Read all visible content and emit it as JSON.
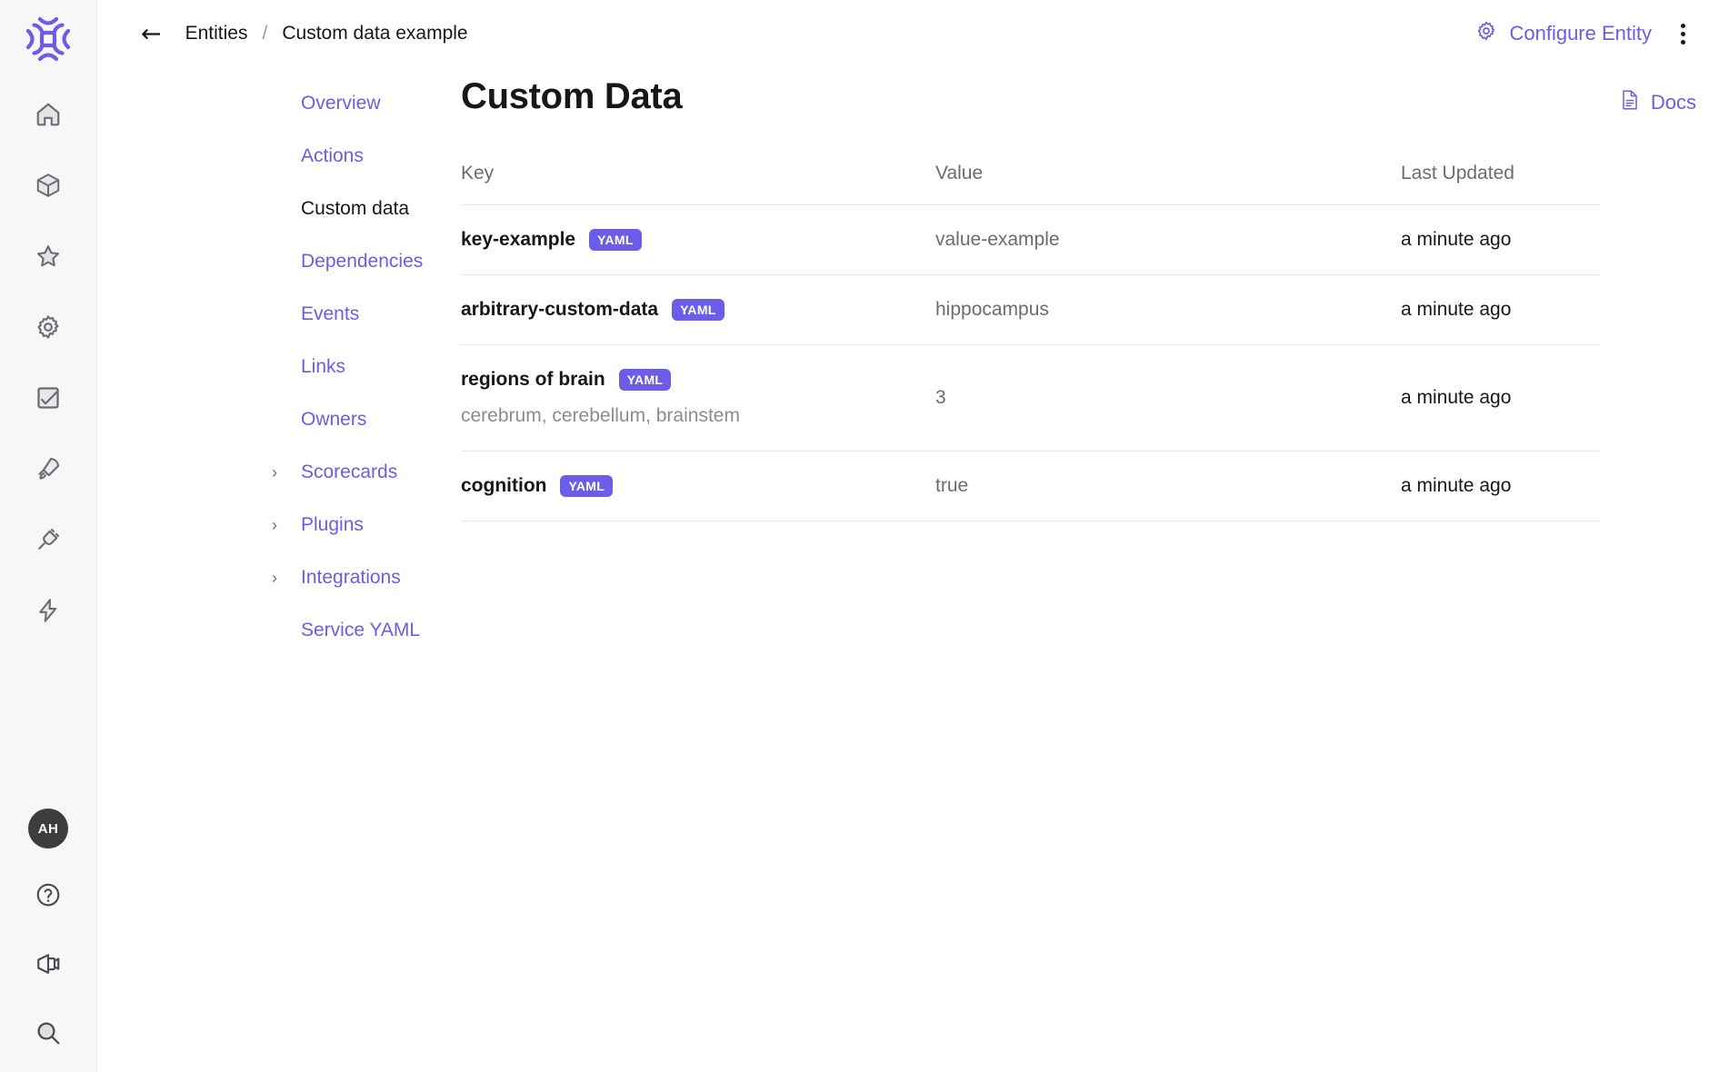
{
  "brand": {
    "logo_name": "cortex-logo",
    "accent": "#6c5ce7"
  },
  "rail": {
    "items": [
      {
        "icon": "home-icon"
      },
      {
        "icon": "cube-icon"
      },
      {
        "icon": "star-icon"
      },
      {
        "icon": "gear-icon"
      },
      {
        "icon": "checkbox-icon"
      },
      {
        "icon": "rocket-icon"
      },
      {
        "icon": "plug-icon"
      },
      {
        "icon": "lightning-icon"
      }
    ],
    "bottom": {
      "avatar_initials": "AH",
      "help_icon": "question-circle-icon",
      "announcements_icon": "megaphone-icon",
      "search_icon": "search-icon"
    }
  },
  "topbar": {
    "back_icon": "arrow-left-icon",
    "breadcrumb": {
      "parent": "Entities",
      "separator": "/",
      "current": "Custom data example"
    },
    "configure_label": "Configure Entity",
    "configure_icon": "gear-icon",
    "more_icon": "kebab-menu-icon"
  },
  "subnav": {
    "items": [
      {
        "label": "Overview",
        "active": false,
        "expandable": false
      },
      {
        "label": "Actions",
        "active": false,
        "expandable": false
      },
      {
        "label": "Custom data",
        "active": true,
        "expandable": false
      },
      {
        "label": "Dependencies",
        "active": false,
        "expandable": false
      },
      {
        "label": "Events",
        "active": false,
        "expandable": false
      },
      {
        "label": "Links",
        "active": false,
        "expandable": false
      },
      {
        "label": "Owners",
        "active": false,
        "expandable": false
      },
      {
        "label": "Scorecards",
        "active": false,
        "expandable": true
      },
      {
        "label": "Plugins",
        "active": false,
        "expandable": true
      },
      {
        "label": "Integrations",
        "active": false,
        "expandable": true
      },
      {
        "label": "Service YAML",
        "active": false,
        "expandable": false
      }
    ],
    "chevron_glyph": "›"
  },
  "main": {
    "title": "Custom Data",
    "docs_label": "Docs",
    "docs_icon": "document-icon",
    "table": {
      "columns": [
        "Key",
        "Value",
        "Last Updated"
      ],
      "rows": [
        {
          "key": "key-example",
          "badge": "YAML",
          "description": "",
          "value": "value-example",
          "updated": "a minute ago"
        },
        {
          "key": "arbitrary-custom-data",
          "badge": "YAML",
          "description": "",
          "value": "hippocampus",
          "updated": "a minute ago"
        },
        {
          "key": "regions of brain",
          "badge": "YAML",
          "description": "cerebrum, cerebellum, brainstem",
          "value": "3",
          "updated": "a minute ago"
        },
        {
          "key": "cognition",
          "badge": "YAML",
          "description": "",
          "value": "true",
          "updated": "a minute ago"
        }
      ]
    }
  }
}
